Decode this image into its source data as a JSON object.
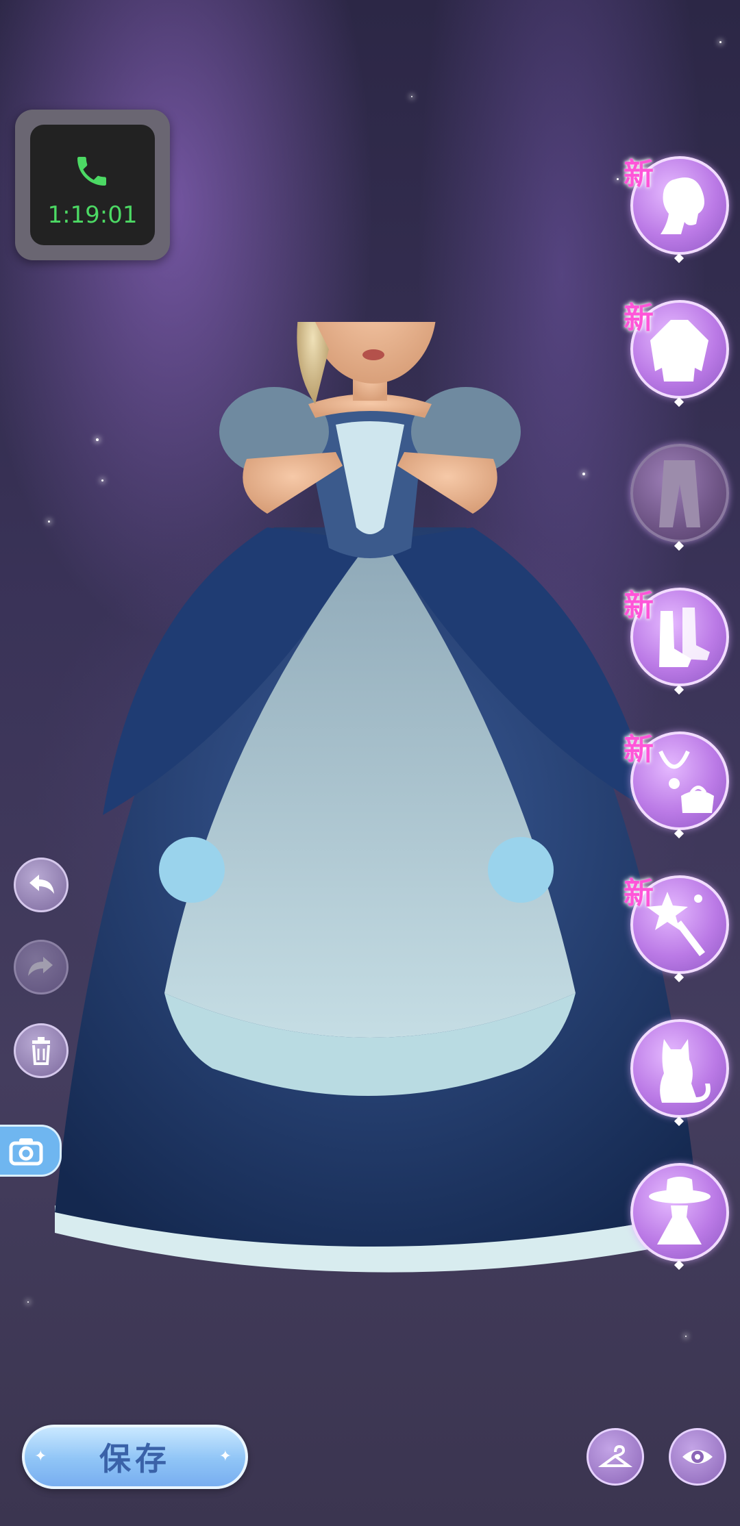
{
  "call": {
    "timer": "1:19:01"
  },
  "categories": [
    {
      "id": "hair",
      "icon": "hair-icon",
      "new_label": "新",
      "enabled": true
    },
    {
      "id": "top",
      "icon": "top-icon",
      "new_label": "新",
      "enabled": true
    },
    {
      "id": "bottom",
      "icon": "pants-icon",
      "new_label": "",
      "enabled": false
    },
    {
      "id": "shoes",
      "icon": "shoes-icon",
      "new_label": "新",
      "enabled": true
    },
    {
      "id": "accessories",
      "icon": "necklace-bag-icon",
      "new_label": "新",
      "enabled": true
    },
    {
      "id": "effects",
      "icon": "magic-wand-icon",
      "new_label": "新",
      "enabled": true
    },
    {
      "id": "pet",
      "icon": "cat-icon",
      "new_label": "",
      "enabled": true
    },
    {
      "id": "outfit",
      "icon": "hat-dress-icon",
      "new_label": "",
      "enabled": true
    }
  ],
  "tools": {
    "undo": "undo-icon",
    "redo": "redo-icon",
    "delete": "trash-icon",
    "camera": "camera-icon"
  },
  "bottom": {
    "save_label": "保存",
    "wardrobe": "hanger-icon",
    "preview": "eye-icon"
  },
  "colors": {
    "accent": "#bb7ae6",
    "save_button": "#8fc4f6",
    "new_badge": "#ff55d8",
    "timer": "#4cd964"
  }
}
